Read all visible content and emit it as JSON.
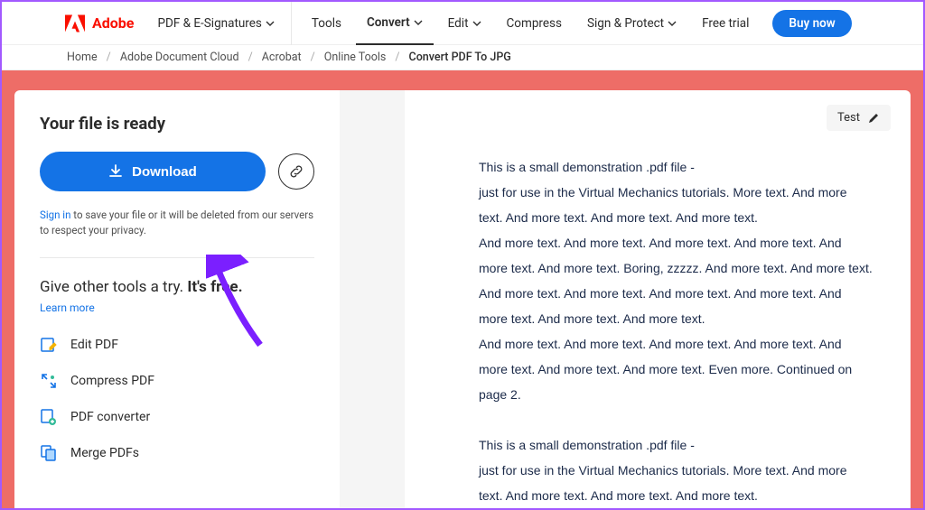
{
  "brand": "Adobe",
  "nav": {
    "pdf": "PDF & E-Signatures",
    "tools": "Tools",
    "convert": "Convert",
    "edit": "Edit",
    "compress": "Compress",
    "sign": "Sign & Protect",
    "trial": "Free trial",
    "buy": "Buy now"
  },
  "breadcrumb": {
    "home": "Home",
    "cloud": "Adobe Document Cloud",
    "acrobat": "Acrobat",
    "online": "Online Tools",
    "current": "Convert PDF To JPG"
  },
  "panel": {
    "title": "Your file is ready",
    "download": "Download",
    "signin": "Sign in",
    "signin_note": " to save your file or it will be deleted from our servers to respect your privacy.",
    "promo_pre": "Give other tools a try. ",
    "promo_bold": "It's free.",
    "learn": "Learn more",
    "tools": {
      "edit": "Edit PDF",
      "compress": "Compress PDF",
      "convert": "PDF converter",
      "merge": "Merge PDFs"
    }
  },
  "preview": {
    "filename": "Test",
    "body": "This is a small demonstration .pdf file -\njust for use in the Virtual Mechanics tutorials. More text. And more text. And more text. And more text. And more text.\nAnd more text. And more text. And more text. And more text. And more text. And more text. Boring, zzzzz. And more text. And more text. And more text. And more text. And more text. And more text. And more text. And more text. And more text.\nAnd more text. And more text. And more text. And more text. And more text. And more text. And more text. Even more. Continued on page 2.\n \nThis is a small demonstration .pdf file -\njust for use in the Virtual Mechanics tutorials. More text. And more text. And more text. And more text. And more text."
  }
}
